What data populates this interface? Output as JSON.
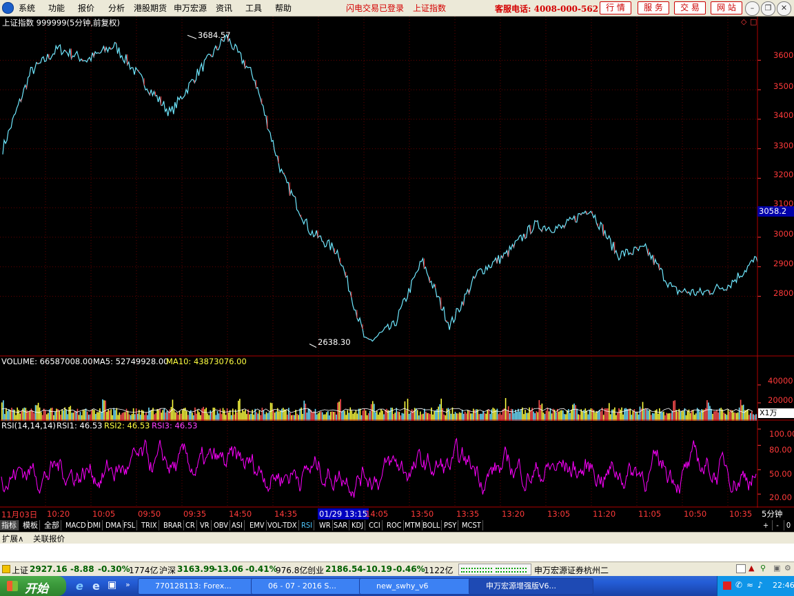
{
  "menubar": {
    "items": [
      "系统",
      "功能",
      "报价",
      "分析",
      "港股期货",
      "申万宏源",
      "资讯",
      "工具",
      "帮助"
    ],
    "login_status": "闪电交易已登录",
    "index_name": "上证指数",
    "hotline": "客服电话: 4008-000-562",
    "buttons": [
      "行 情",
      "服 务",
      "交 易",
      "网 站"
    ]
  },
  "price_panel": {
    "title": "上证指数 999999(5分钟,前复权)",
    "high_label": "3684.57",
    "low_label": "2638.30",
    "current_price": "3058.2",
    "y_ticks": [
      "3600",
      "3500",
      "3400",
      "3300",
      "3200",
      "3100",
      "3000",
      "2900",
      "2800"
    ]
  },
  "volume_panel": {
    "label": "VOLUME: 66587008.00",
    "ma5": "MA5: 52749928.00",
    "ma10": "MA10: 43873076.00",
    "y_ticks": [
      "40000",
      "20000"
    ],
    "unit": "X1万"
  },
  "rsi_panel": {
    "label": "RSI(14,14,14)",
    "rsi1": "RSI1: 46.53",
    "rsi2": "RSI2: 46.53",
    "rsi3": "RSI3: 46.53",
    "y_ticks": [
      "100.00",
      "80.00",
      "50.00",
      "20.00"
    ]
  },
  "time_axis": {
    "labels": [
      "11月03日",
      "10:20",
      "10:05",
      "09:50",
      "09:35",
      "14:50",
      "14:35",
      "01/29 13:15",
      "14:05",
      "13:50",
      "13:35",
      "13:20",
      "13:05",
      "11:20",
      "11:05",
      "10:50",
      "10:35"
    ],
    "period": "5分钟"
  },
  "indicator_tabs": [
    "指标",
    "模板",
    "全部",
    "MACD",
    "DMI",
    "DMA",
    "FSL",
    "TRIX",
    "BRAR",
    "CR",
    "VR",
    "OBV",
    "ASI",
    "EMV",
    "VOL-TDX",
    "RSI",
    "WR",
    "SAR",
    "KDJ",
    "CCI",
    "ROC",
    "MTM",
    "BOLL",
    "PSY",
    "MCST"
  ],
  "indicator_controls": [
    "+",
    "-",
    "0"
  ],
  "bottom_tabs": [
    "扩展∧",
    "关联报价"
  ],
  "status_bar": {
    "sh_label": "上证",
    "sh_value": "2927.16",
    "sh_change": "-8.88",
    "sh_pct": "-0.30%",
    "sh_amount": "1774亿",
    "hs_label": "沪深",
    "hs_value": "3163.99",
    "hs_change": "-13.06",
    "hs_pct": "-0.41%",
    "hs_amount": "976.8亿",
    "cy_label": "创业",
    "cy_value": "2186.54",
    "cy_change": "-10.19",
    "cy_pct": "-0.46%",
    "cy_amount": "1122亿",
    "broker": "申万宏源证券杭州二"
  },
  "taskbar": {
    "start": "开始",
    "tasks": [
      "770128113: Forex...",
      "06 - 07 - 2016 S...",
      "new_swhy_v6",
      "申万宏源增强版V6..."
    ],
    "clock": "22:46"
  },
  "colors": {
    "price_line": "#6fe8ff",
    "down_red": "#ff3a3a",
    "rsi_magenta": "#ff00ff",
    "vol_yellow": "#ffff40",
    "axis_red": "#b00000"
  },
  "chart_data": {
    "type": "line",
    "title": "上证指数 999999(5分钟,前复权)",
    "xlabel": "",
    "ylabel": "",
    "ylim": [
      2600,
      3720
    ],
    "x": [
      "11月03日",
      "10:20",
      "10:05",
      "09:50",
      "09:35",
      "14:50",
      "14:35",
      "01/29 13:15",
      "14:05",
      "13:50",
      "13:35",
      "13:20",
      "13:05",
      "11:20",
      "11:05",
      "10:50",
      "10:35"
    ],
    "series": [
      {
        "values": [
          3300,
          3560,
          3640,
          3600,
          3650,
          3530,
          3420,
          3560,
          3680,
          3540,
          3210,
          3020,
          2950,
          2640,
          2700,
          2920,
          2700,
          2880,
          2940,
          3040,
          3030,
          3100,
          2940,
          2960,
          2820,
          2810,
          2840,
          2930
        ]
      }
    ],
    "high": 3684.57,
    "low": 2638.3,
    "current": 3058.2
  }
}
